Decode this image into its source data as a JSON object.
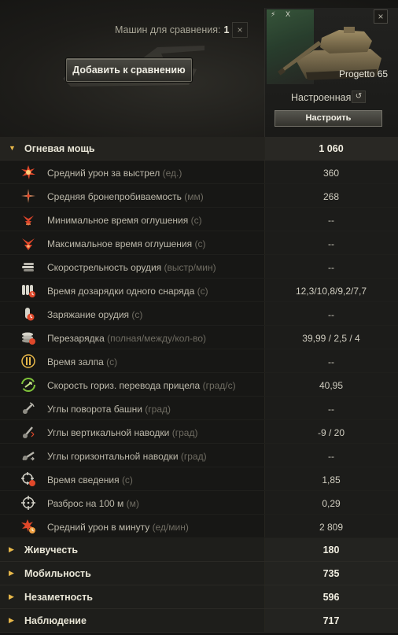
{
  "header": {
    "compare_label": "Машин для сравнения:",
    "compare_count": "1",
    "close_symbol": "×",
    "add_button": "Добавить к сравнению"
  },
  "tank": {
    "badge_1": "⚡",
    "badge_2": "X",
    "name": "Progetto 65",
    "close_symbol": "×",
    "config_label": "Настроенная",
    "reset_symbol": "↺",
    "configure_button": "Настроить"
  },
  "sections": [
    {
      "id": "firepower",
      "title": "Огневая мощь",
      "value": "1 060",
      "expanded": true
    },
    {
      "id": "survivability",
      "title": "Живучесть",
      "value": "180",
      "expanded": false
    },
    {
      "id": "mobility",
      "title": "Мобильность",
      "value": "735",
      "expanded": false
    },
    {
      "id": "concealment",
      "title": "Незаметность",
      "value": "596",
      "expanded": false
    },
    {
      "id": "spotting",
      "title": "Наблюдение",
      "value": "717",
      "expanded": false
    }
  ],
  "firepower_stats": [
    {
      "icon": "damage-burst-icon",
      "label": "Средний урон за выстрел",
      "unit": "(ед.)",
      "value": "360"
    },
    {
      "icon": "penetration-icon",
      "label": "Средняя бронепробиваемость",
      "unit": "(мм)",
      "value": "268"
    },
    {
      "icon": "stun-min-icon",
      "label": "Минимальное время оглушения",
      "unit": "(с)",
      "value": "--"
    },
    {
      "icon": "stun-max-icon",
      "label": "Максимальное время оглушения",
      "unit": "(с)",
      "value": "--"
    },
    {
      "icon": "rate-of-fire-icon",
      "label": "Скорострельность орудия",
      "unit": "(выстр/мин)",
      "value": "--"
    },
    {
      "icon": "clip-reload-icon",
      "label": "Время дозарядки одного снаряда",
      "unit": "(с)",
      "value": "12,3/10,8/9,2/7,7"
    },
    {
      "icon": "loading-icon",
      "label": "Заряжание орудия",
      "unit": "(с)",
      "value": "--"
    },
    {
      "icon": "reload-stack-icon",
      "label": "Перезарядка",
      "unit": "(полная/между/кол-во)",
      "value": "39,99 / 2,5 / 4"
    },
    {
      "icon": "salvo-icon",
      "label": "Время залпа",
      "unit": "(с)",
      "value": "--"
    },
    {
      "icon": "turret-traverse-icon",
      "label": "Скорость гориз. перевода прицела",
      "unit": "(град/с)",
      "value": "40,95"
    },
    {
      "icon": "turret-rotation-icon",
      "label": "Углы поворота башни",
      "unit": "(град)",
      "value": "--"
    },
    {
      "icon": "gun-elevation-icon",
      "label": "Углы вертикальной наводки",
      "unit": "(град)",
      "value": "-9 / 20"
    },
    {
      "icon": "gun-horizontal-icon",
      "label": "Углы горизонтальной наводки",
      "unit": "(град)",
      "value": "--"
    },
    {
      "icon": "aim-time-icon",
      "label": "Время сведения",
      "unit": "(с)",
      "value": "1,85"
    },
    {
      "icon": "dispersion-icon",
      "label": "Разброс на 100 м",
      "unit": "(м)",
      "value": "0,29"
    },
    {
      "icon": "damage-per-minute-icon",
      "label": "Средний урон в минуту",
      "unit": "(ед/мин)",
      "value": "2 809"
    }
  ],
  "colors": {
    "accent_orange": "#e8b84a",
    "icon_red": "#e0482a",
    "icon_green": "#7fc23a",
    "icon_silver": "#b8b6ad"
  }
}
